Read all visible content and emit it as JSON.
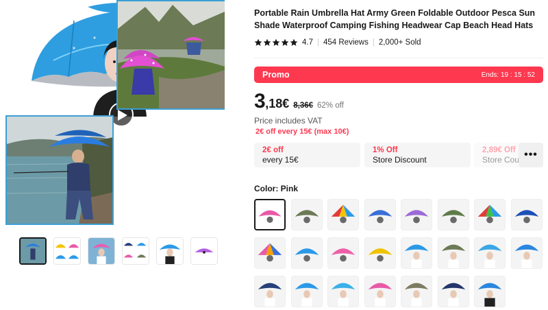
{
  "product": {
    "title": "Portable Rain Umbrella Hat Army Green Foldable Outdoor Pesca Sun Shade Waterproof Camping Fishing Headwear Cap Beach Head Hats",
    "rating": "4.7",
    "reviews": "454 Reviews",
    "sold": "2,000+ Sold"
  },
  "promo": {
    "label": "Promo",
    "timer": "Ends: 19 : 15 : 52"
  },
  "price": {
    "integer": "3",
    "decimal": ",18€",
    "original": "8,36€",
    "discount": "62% off",
    "vat_note": "Price includes VAT",
    "offer": "2€ off every 15€ (max 10€)"
  },
  "coupons": [
    {
      "top": "2€ off",
      "bottom": "every 15€"
    },
    {
      "top": "1% Off",
      "bottom": "Store Discount"
    },
    {
      "top": "2,89€ Off",
      "bottom": "Store Cou"
    }
  ],
  "more_label": "•••",
  "color": {
    "label": "Color: Pink",
    "accent": "#fd384f"
  },
  "swatches": [
    {
      "kind": "pink",
      "selected": true
    },
    {
      "kind": "camo"
    },
    {
      "kind": "rainbow"
    },
    {
      "kind": "blue"
    },
    {
      "kind": "purple"
    },
    {
      "kind": "camo-green"
    },
    {
      "kind": "rainbow2"
    },
    {
      "kind": "blue-dark"
    },
    {
      "kind": "multi"
    },
    {
      "kind": "sky"
    },
    {
      "kind": "pink2"
    },
    {
      "kind": "yellow"
    },
    {
      "kind": "person-blue"
    },
    {
      "kind": "person-camo"
    },
    {
      "kind": "person-sky"
    },
    {
      "kind": "person-blue2"
    },
    {
      "kind": "person-navy"
    },
    {
      "kind": "person-blue3"
    },
    {
      "kind": "person-sky2"
    },
    {
      "kind": "person-pink"
    },
    {
      "kind": "person-camo2"
    },
    {
      "kind": "person-navy2"
    },
    {
      "kind": "person-blue4"
    }
  ],
  "icons": {
    "play": "play-icon",
    "star": "star-icon",
    "more": "more-icon"
  }
}
